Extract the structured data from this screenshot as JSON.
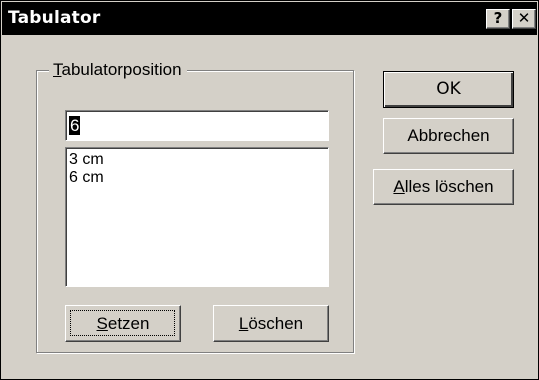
{
  "window": {
    "title": "Tabulator",
    "help_glyph": "?",
    "close_glyph": "✕"
  },
  "group": {
    "mnemonic": "T",
    "label_rest": "abulatorposition"
  },
  "input": {
    "value": "6"
  },
  "list": {
    "items": [
      "3 cm",
      "6 cm"
    ]
  },
  "buttons": {
    "ok": "OK",
    "cancel": "Abbrechen",
    "clear_all_mnemonic": "A",
    "clear_all_rest": "lles löschen",
    "set_mnemonic": "S",
    "set_rest": "etzen",
    "delete_mnemonic": "L",
    "delete_rest": "öschen"
  }
}
